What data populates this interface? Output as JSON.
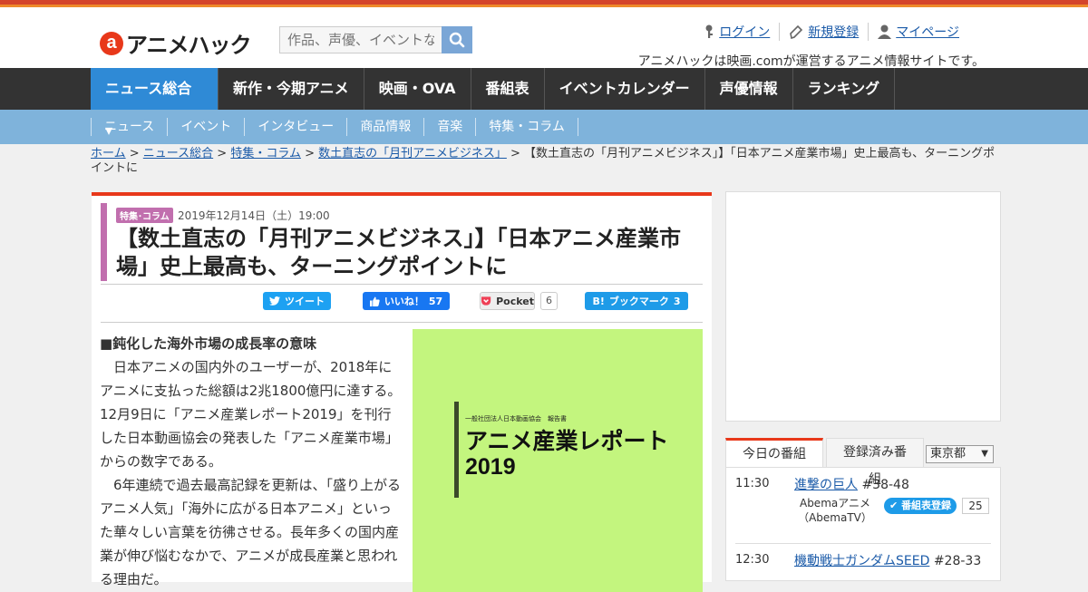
{
  "header": {
    "logo_mark": "a",
    "logo_text": "アニメハック",
    "search_placeholder": "作品、声優、イベントなど",
    "links": [
      {
        "label": "ログイン",
        "icon": "key-icon"
      },
      {
        "label": "新規登録",
        "icon": "pen-icon"
      },
      {
        "label": "マイページ",
        "icon": "user-icon"
      }
    ],
    "tagline": "アニメハックは映画.comが運営するアニメ情報サイトです。"
  },
  "gnav": [
    "ニュース総合 ▾",
    "新作・今期アニメ",
    "映画・OVA",
    "番組表",
    "イベントカレンダー",
    "声優情報",
    "ランキング"
  ],
  "subnav": [
    "ニュース",
    "イベント",
    "インタビュー",
    "商品情報",
    "音楽",
    "特集・コラム"
  ],
  "breadcrumb": {
    "items": [
      "ホーム",
      "ニュース総合",
      "特集・コラム",
      "数土直志の「月刊アニメビジネス」"
    ],
    "current": "【数土直志の「月刊アニメビジネス」】「日本アニメ産業市場」史上最高も、ターニングポイントに"
  },
  "article": {
    "tag": "特集･コラム",
    "date": "2019年12月14日（土）19:00",
    "title": "【数土直志の「月刊アニメビジネス」】「日本アニメ産業市場」史上最高も、ターニングポイントに",
    "social": {
      "tweet": "ツイート",
      "like": "いいね！",
      "like_count": "57",
      "pocket": "Pocket",
      "pocket_count": "6",
      "hatena": "ブックマーク",
      "hatena_count": "3"
    },
    "heading": "■鈍化した海外市場の成長率の意味",
    "paragraphs": [
      "日本アニメの国内外のユーザーが、2018年にアニメに支払った総額は2兆1800億円に達する。12月9日に「アニメ産業レポート2019」を刊行した日本動画協会の発表した「アニメ産業市場」からの数字である。",
      "6年連続で過去最高記録を更新は、「盛り上がるアニメ人気」「海外に広がる日本アニメ」といった華々しい言葉を彷彿させる。長年多くの国内産業が伸び悩むなかで、アニメが成長産業と思われる理由だ。"
    ],
    "image": {
      "small_text": "一般社団法人日本動画協会　報告書",
      "title_line1": "アニメ産業レポート",
      "title_line2": "2019"
    }
  },
  "tv": {
    "tab_today": "今日の番組",
    "tab_registered": "登録済み番組",
    "prefecture": "東京都",
    "rows": [
      {
        "time": "11:30",
        "title": "進撃の巨人",
        "ep": "#38-48",
        "channel": "Abemaアニメ（AbemaTV）",
        "register": "番組表登録",
        "count": "25"
      },
      {
        "time": "12:30",
        "title": "機動戦士ガンダムSEED",
        "ep": "#28-33"
      }
    ]
  }
}
